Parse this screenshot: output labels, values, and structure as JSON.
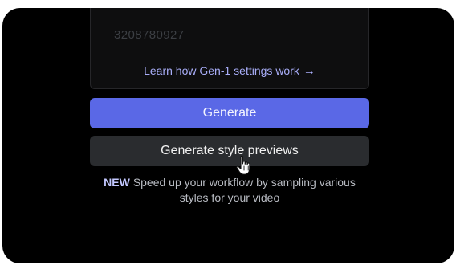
{
  "settings": {
    "seed_value": "3208780927",
    "learn_link_label": "Learn how Gen-1 settings work",
    "learn_link_arrow": "→"
  },
  "actions": {
    "generate_label": "Generate",
    "previews_label": "Generate style previews"
  },
  "promo": {
    "badge": "NEW",
    "text": "Speed up your workflow by sampling various styles for your video"
  },
  "colors": {
    "primary_button": "#5a68e6",
    "secondary_button": "#2a2c2f",
    "link": "#a9aef9"
  },
  "icons": {
    "cursor": "hand-pointer-icon"
  }
}
